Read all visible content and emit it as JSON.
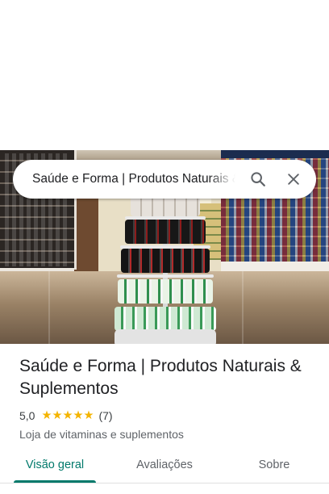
{
  "search": {
    "query": "Saúde e Forma | Produtos Naturais & Suplementos",
    "search_icon": "search-icon",
    "close_icon": "close-icon"
  },
  "hero": {
    "image": "store-interior-photo"
  },
  "place": {
    "name": "Saúde e Forma | Produtos Naturais & Suplementos",
    "rating": "5,0",
    "stars": 5,
    "review_count": "(7)",
    "category": "Loja de vitaminas e suplementos"
  },
  "tabs": [
    {
      "label": "Visão geral",
      "active": true
    },
    {
      "label": "Avaliações",
      "active": false
    },
    {
      "label": "Sobre",
      "active": false
    }
  ],
  "colors": {
    "accent": "#00796b",
    "star": "#f4b400",
    "text_primary": "#202124",
    "text_secondary": "#5f6368"
  }
}
